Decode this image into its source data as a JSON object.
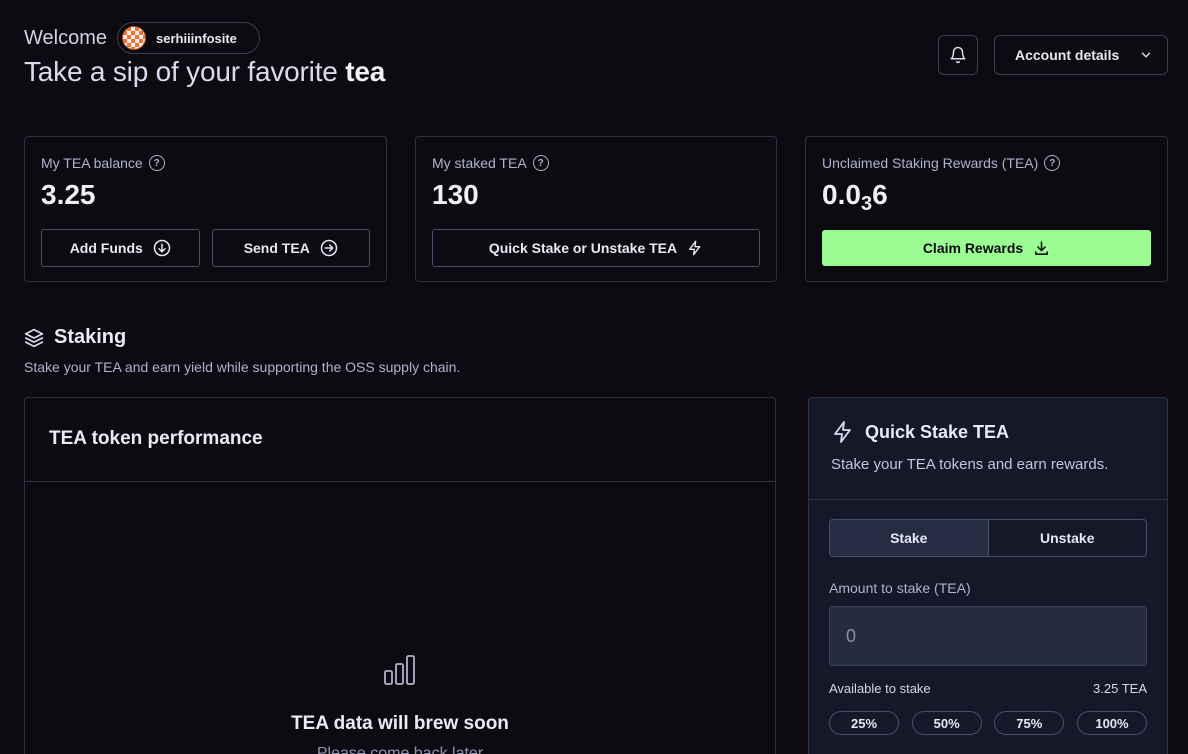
{
  "header": {
    "welcome": "Welcome",
    "username": "serhiiinfosite",
    "headline_prefix": "Take a sip of your favorite ",
    "headline_bold": "tea",
    "account_button": "Account details"
  },
  "stats": {
    "balance": {
      "label": "My TEA balance",
      "value": "3.25",
      "add_funds": "Add Funds",
      "send": "Send TEA"
    },
    "staked": {
      "label": "My staked TEA",
      "value": "130",
      "quick_stake": "Quick Stake or Unstake TEA"
    },
    "rewards": {
      "label": "Unclaimed Staking Rewards (TEA)",
      "value_main": "0.0",
      "value_sub": "3",
      "value_end": "6",
      "claim": "Claim Rewards"
    }
  },
  "staking": {
    "title": "Staking",
    "subtitle": "Stake your TEA and earn yield while supporting the OSS supply chain."
  },
  "performance": {
    "title": "TEA token performance",
    "empty_title": "TEA data will brew soon",
    "empty_sub": "Please come back later"
  },
  "quick_stake": {
    "title": "Quick Stake TEA",
    "subtitle": "Stake your TEA tokens and earn rewards.",
    "tab_stake": "Stake",
    "tab_unstake": "Unstake",
    "amount_label": "Amount to stake (TEA)",
    "amount_placeholder": "0",
    "available_label": "Available to stake",
    "available_value": "3.25 TEA",
    "pct": [
      "25%",
      "50%",
      "75%",
      "100%"
    ]
  },
  "colors": {
    "background": "#0d0b11",
    "accent_green": "#9bfc94",
    "card_border": "#2c3042"
  }
}
